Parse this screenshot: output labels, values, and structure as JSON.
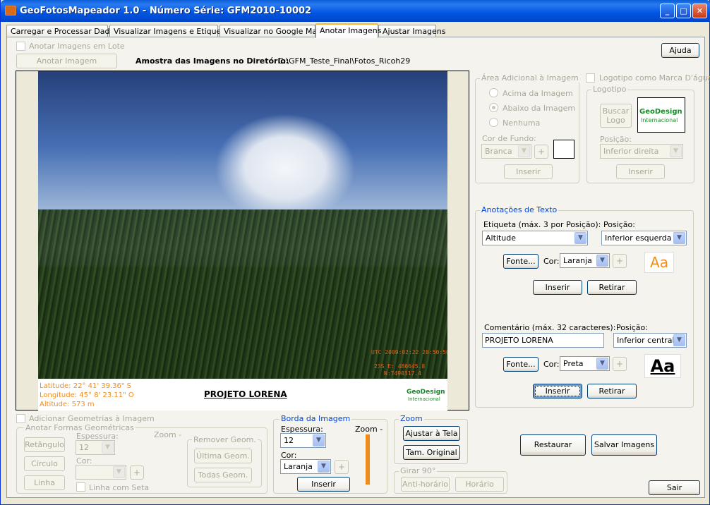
{
  "window": {
    "title": "GeoFotosMapeador 1.0 - Número Série: GFM2010-10002"
  },
  "tabs": [
    "Carregar e Processar Dados",
    "Visualizar Imagens e Etiquetas",
    "Visualizar no Google Maps",
    "Anotar Imagens",
    "Ajustar Imagens"
  ],
  "top": {
    "batch_label": "Anotar Imagens em Lote",
    "individual_button": "Anotar Imagem Individual",
    "sample_label": "Amostra das Imagens no Diretório:",
    "directory": "C:\\GFM_Teste_Final\\Fotos_Ricoh29",
    "help_button": "Ajuda"
  },
  "photo": {
    "stamp_line1": "UTC 2009:02:22 20:50:50",
    "stamp_line2": "23S E: 486645.8",
    "stamp_line3": "N:7490317.4",
    "latitude": "Latitude: 22° 41' 39.36\" S",
    "longitude": "Longitude: 45° 8' 23.11\" O",
    "altitude": "Altitude: 573 m",
    "comment": "PROJETO LORENA",
    "logo_line1": "GeoDesign",
    "logo_line2": "Internacional"
  },
  "area": {
    "title": "Área Adicional à Imagem",
    "above": "Acima da Imagem",
    "below": "Abaixo da Imagem",
    "none": "Nenhuma",
    "bg_label": "Cor de Fundo:",
    "bg_value": "Branca",
    "insert": "Inserir"
  },
  "logo": {
    "checkbox": "Logotipo como Marca D'água",
    "group": "Logotipo",
    "search_button": "Buscar Logo",
    "preview_line1": "GeoDesign",
    "preview_line2": "Internacional",
    "position_label": "Posição:",
    "position_value": "Inferior direita",
    "insert": "Inserir"
  },
  "text_annot": {
    "title": "Anotações de Texto",
    "label_label": "Etiqueta (máx. 3 por Posição):",
    "label_value": "Altitude",
    "position_label": "Posição:",
    "position_value": "Inferior esquerda",
    "font_button": "Fonte...",
    "color_label": "Cor:",
    "color_value": "Laranja",
    "preview": "Aa",
    "insert": "Inserir",
    "remove": "Retirar",
    "comment_label": "Comentário (máx. 32 caracteres):",
    "comment_value": "PROJETO LORENA",
    "comment_pos_label": "Posição:",
    "comment_pos_value": "Inferior central",
    "font_button2": "Fonte...",
    "color_label2": "Cor:",
    "color_value2": "Preta",
    "preview2": "Aa",
    "insert2": "Inserir",
    "remove2": "Retirar"
  },
  "geom": {
    "checkbox": "Adicionar Geometrias à Imagem",
    "group": "Anotar Formas Geométricas",
    "zoom": "Zoom -",
    "rect": "Retângulo",
    "circle": "Círculo",
    "line": "Linha",
    "thickness_label": "Espessura:",
    "thickness_value": "12",
    "color_label": "Cor:",
    "dashed": "Linha com Seta",
    "remove_group": "Remover  Geom.",
    "last": "Última Geom.",
    "all": "Todas Geom."
  },
  "border": {
    "title": "Borda da Imagem",
    "thickness_label": "Espessura:",
    "thickness_value": "12",
    "zoom": "Zoom -",
    "color_label": "Cor:",
    "color_value": "Laranja",
    "insert": "Inserir",
    "swatch_color": "#f08c1c"
  },
  "zoom": {
    "title": "Zoom",
    "fit": "Ajustar à Tela",
    "original": "Tam. Original"
  },
  "rotate": {
    "title": "Girar 90°",
    "ccw": "Anti-horário",
    "cw": "Horário"
  },
  "actions": {
    "restore": "Restaurar",
    "save": "Salvar Imagens",
    "exit": "Sair"
  },
  "colors": {
    "orange": "#f08c1c",
    "accent": "#0046d5"
  }
}
